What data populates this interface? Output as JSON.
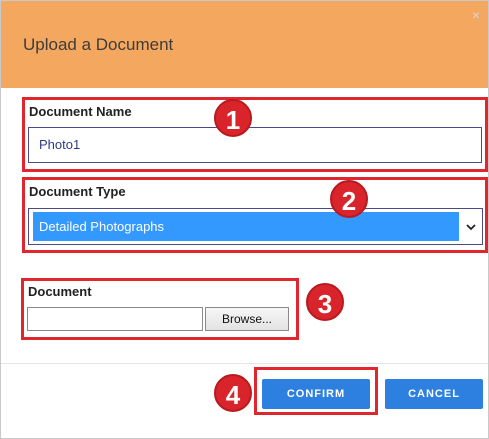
{
  "dialog": {
    "title": "Upload a Document",
    "close_glyph": "×"
  },
  "fields": {
    "document_name_label": "Document Name",
    "document_name_value": "Photo1",
    "document_type_label": "Document Type",
    "document_type_value": "Detailed Photographs",
    "document_label": "Document",
    "browse_label": "Browse..."
  },
  "actions": {
    "confirm_label": "CONFIRM",
    "cancel_label": "CANCEL"
  },
  "annotations": {
    "badge_1": "1",
    "badge_2": "2",
    "badge_3": "3",
    "badge_4": "4",
    "highlight_color": "#e0262e"
  },
  "colors": {
    "title_bar": "#f4a85f",
    "select_highlight": "#3399ff",
    "button": "#2d7fe0"
  },
  "icons": {
    "select_arrow": "chevron-down-icon",
    "close": "close-icon"
  }
}
